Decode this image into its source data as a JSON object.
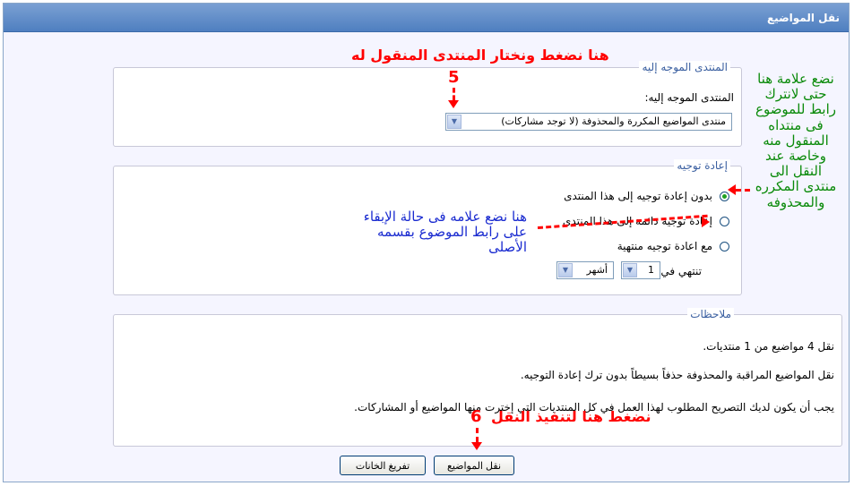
{
  "window": {
    "title": "نقل المواضيع"
  },
  "destination": {
    "legend": "المنتدى الموجه إليه",
    "label": "المنتدى الموجه إليه:",
    "selected_forum": "منتدى المواضيع المكررة والمحذوفة (لا توجد مشاركات)"
  },
  "redirect": {
    "legend": "إعادة توجيه",
    "options": [
      {
        "label": "بدون إعادة توجيه إلى هذا المنتدى",
        "selected": true
      },
      {
        "label": "إعادة توجيه دائمة إلى هذا المنتدى",
        "selected": false
      },
      {
        "label": "مع اعادة توجيه منتهية",
        "selected": false
      }
    ],
    "expires_label": "تنتهي في",
    "amount": "1",
    "unit": "أشهر"
  },
  "notes": {
    "legend": "ملاحظات",
    "lines": [
      "نقل 4 مواضيع من 1 منتديات.",
      "نقل المواضيع المراقبة والمحذوفة حذفاً بسيطاً بدون ترك إعادة التوجيه.",
      "يجب أن يكون لديك التصريح المطلوب لهذا العمل في كل المنتديات التي إخترت منها المواضيع أو المشاركات."
    ]
  },
  "buttons": {
    "move": "نقل المواضيع",
    "reset": "تفريغ الخانات"
  },
  "annotations": {
    "step5_number": "5",
    "step5_text": "هنا نضغط ونختار المنتدى المنقول له",
    "step6_number": "6",
    "step6_text": "نضغط هنا لتنفيذ النقل",
    "blue_note": "هنا نضع علامه فى حالة الإبقاء على رابط الموضوع بقسمه الأصلى",
    "green_note": "نضع علامة هنا حتى لانترك رابط للموضوع فى منتداه المنقول منه وخاصة عند النقل الى منتدى المكرره والمحذوفه"
  },
  "colors": {
    "title_bar": "#5a87c6",
    "annotation_red": "#ff0000",
    "annotation_blue": "#1a2bd0",
    "annotation_green": "#0a8a0a"
  }
}
